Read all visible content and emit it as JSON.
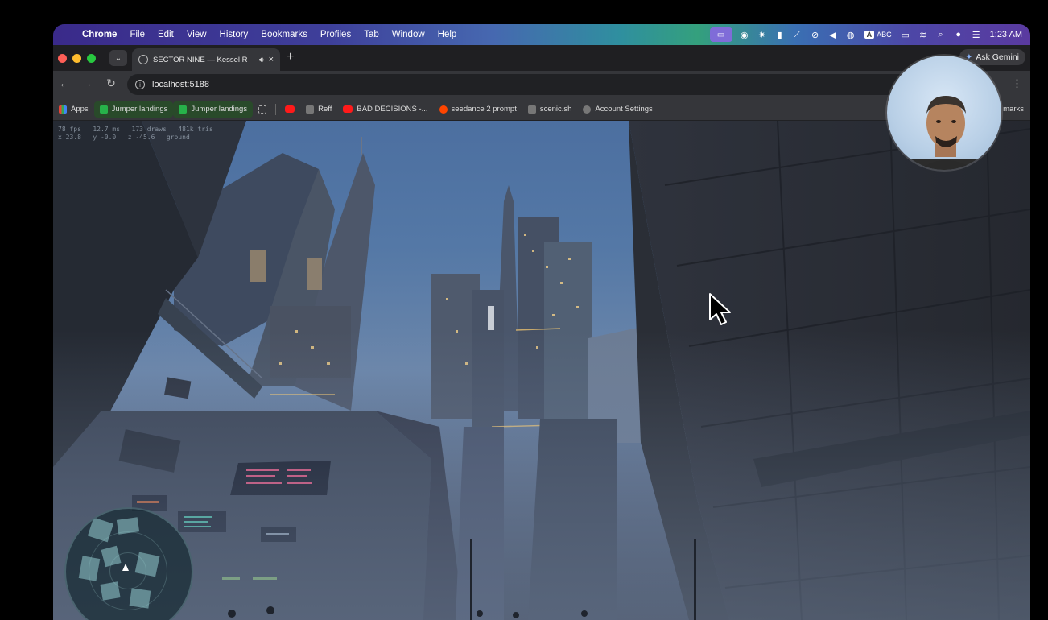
{
  "menubar": {
    "app": "Chrome",
    "items": [
      "File",
      "Edit",
      "View",
      "History",
      "Bookmarks",
      "Profiles",
      "Tab",
      "Window",
      "Help"
    ],
    "input_source": "ABC",
    "clock": "1:23 AM"
  },
  "tabs": {
    "active_title": "SECTOR NINE — Kessel R",
    "new_tab": "+",
    "close": "×"
  },
  "toolbar": {
    "url": "localhost:5188",
    "ask_gemini": "Ask Gemini"
  },
  "bookmarks": {
    "apps": "Apps",
    "items": [
      {
        "label": "Jumper landings",
        "icon": "green-check-icon"
      },
      {
        "label": "Jumper landings",
        "icon": "green-check-icon"
      },
      {
        "label": "Reff",
        "icon": "site-icon"
      },
      {
        "label": "BAD DECISIONS -...",
        "icon": "youtube-icon"
      },
      {
        "label": "seedance 2 prompt",
        "icon": "reddit-icon"
      },
      {
        "label": "scenic.sh",
        "icon": "terminal-icon"
      },
      {
        "label": "Account Settings",
        "icon": "settings-icon"
      }
    ],
    "overflow": "marks"
  },
  "game": {
    "hud_line1": "78 fps   12.7 ms   173 draws   481k tris",
    "hud_line2": "x 23.8   y -0.0   z -45.6   ground"
  },
  "colors": {
    "accent": "#8ab4f8",
    "sky": "#5478a6",
    "building_light": "#ffd98a"
  }
}
